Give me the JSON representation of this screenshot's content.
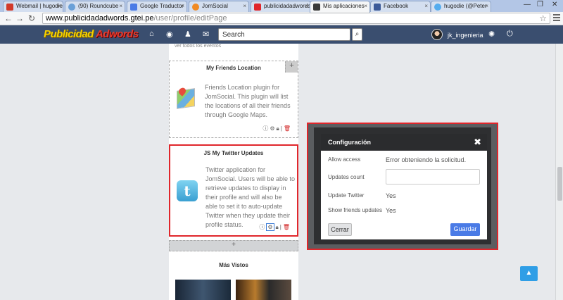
{
  "browser": {
    "tabs": [
      {
        "label": "Webmail | hugodie",
        "color": "#d23a2a"
      },
      {
        "label": "(90) Roundcube",
        "color": "#6aa0d8"
      },
      {
        "label": "Google Traductor",
        "color": "#4a7be6"
      },
      {
        "label": "JomSocial",
        "color": "#f08a24"
      },
      {
        "label": "publicidadadwords",
        "color": "#e0262b"
      },
      {
        "label": "Mis aplicaciones",
        "color": "#3a3a3a"
      },
      {
        "label": "Facebook",
        "color": "#3b5998"
      },
      {
        "label": "hugodie (@Peter",
        "color": "#55acee"
      }
    ],
    "url_host": "www.publicidadadwords.gtei.pe",
    "url_path": "/user/profile/editPage"
  },
  "header": {
    "logo_part1": "Publicidad",
    "logo_part2": "Adwords",
    "search_placeholder": "Search",
    "username": "jk_ingenieria"
  },
  "profile": {
    "cutoff_text": "ver todos los eventos",
    "apps": [
      {
        "title": "My Friends Location",
        "description": "Friends Location plugin for JomSocial. This plugin will list the locations of all their friends through Google Maps."
      },
      {
        "title": "JS My Twitter Updates",
        "description": "Twitter application for JomSocial. Users will be able to retrieve updates to display in their profile and will also be able to set it to auto-update Twitter when they update their profile status."
      }
    ],
    "add_symbol": "+",
    "mas_vistos": "Más Vistos"
  },
  "dialog": {
    "title": "Configuración",
    "close_symbol": "✖",
    "rows": [
      {
        "label": "Allow access",
        "value": "Error obteniendo la solicitud."
      },
      {
        "label": "Updates count",
        "value": ""
      },
      {
        "label": "Update Twitter",
        "value": "Yes"
      },
      {
        "label": "Show friends updates",
        "value": "Yes"
      }
    ],
    "cancel_label": "Cerrar",
    "save_label": "Guardar"
  },
  "colors": {
    "header_bg": "#3a4e6f",
    "highlight_red": "#e0262b",
    "primary_blue": "#4a7be6"
  }
}
